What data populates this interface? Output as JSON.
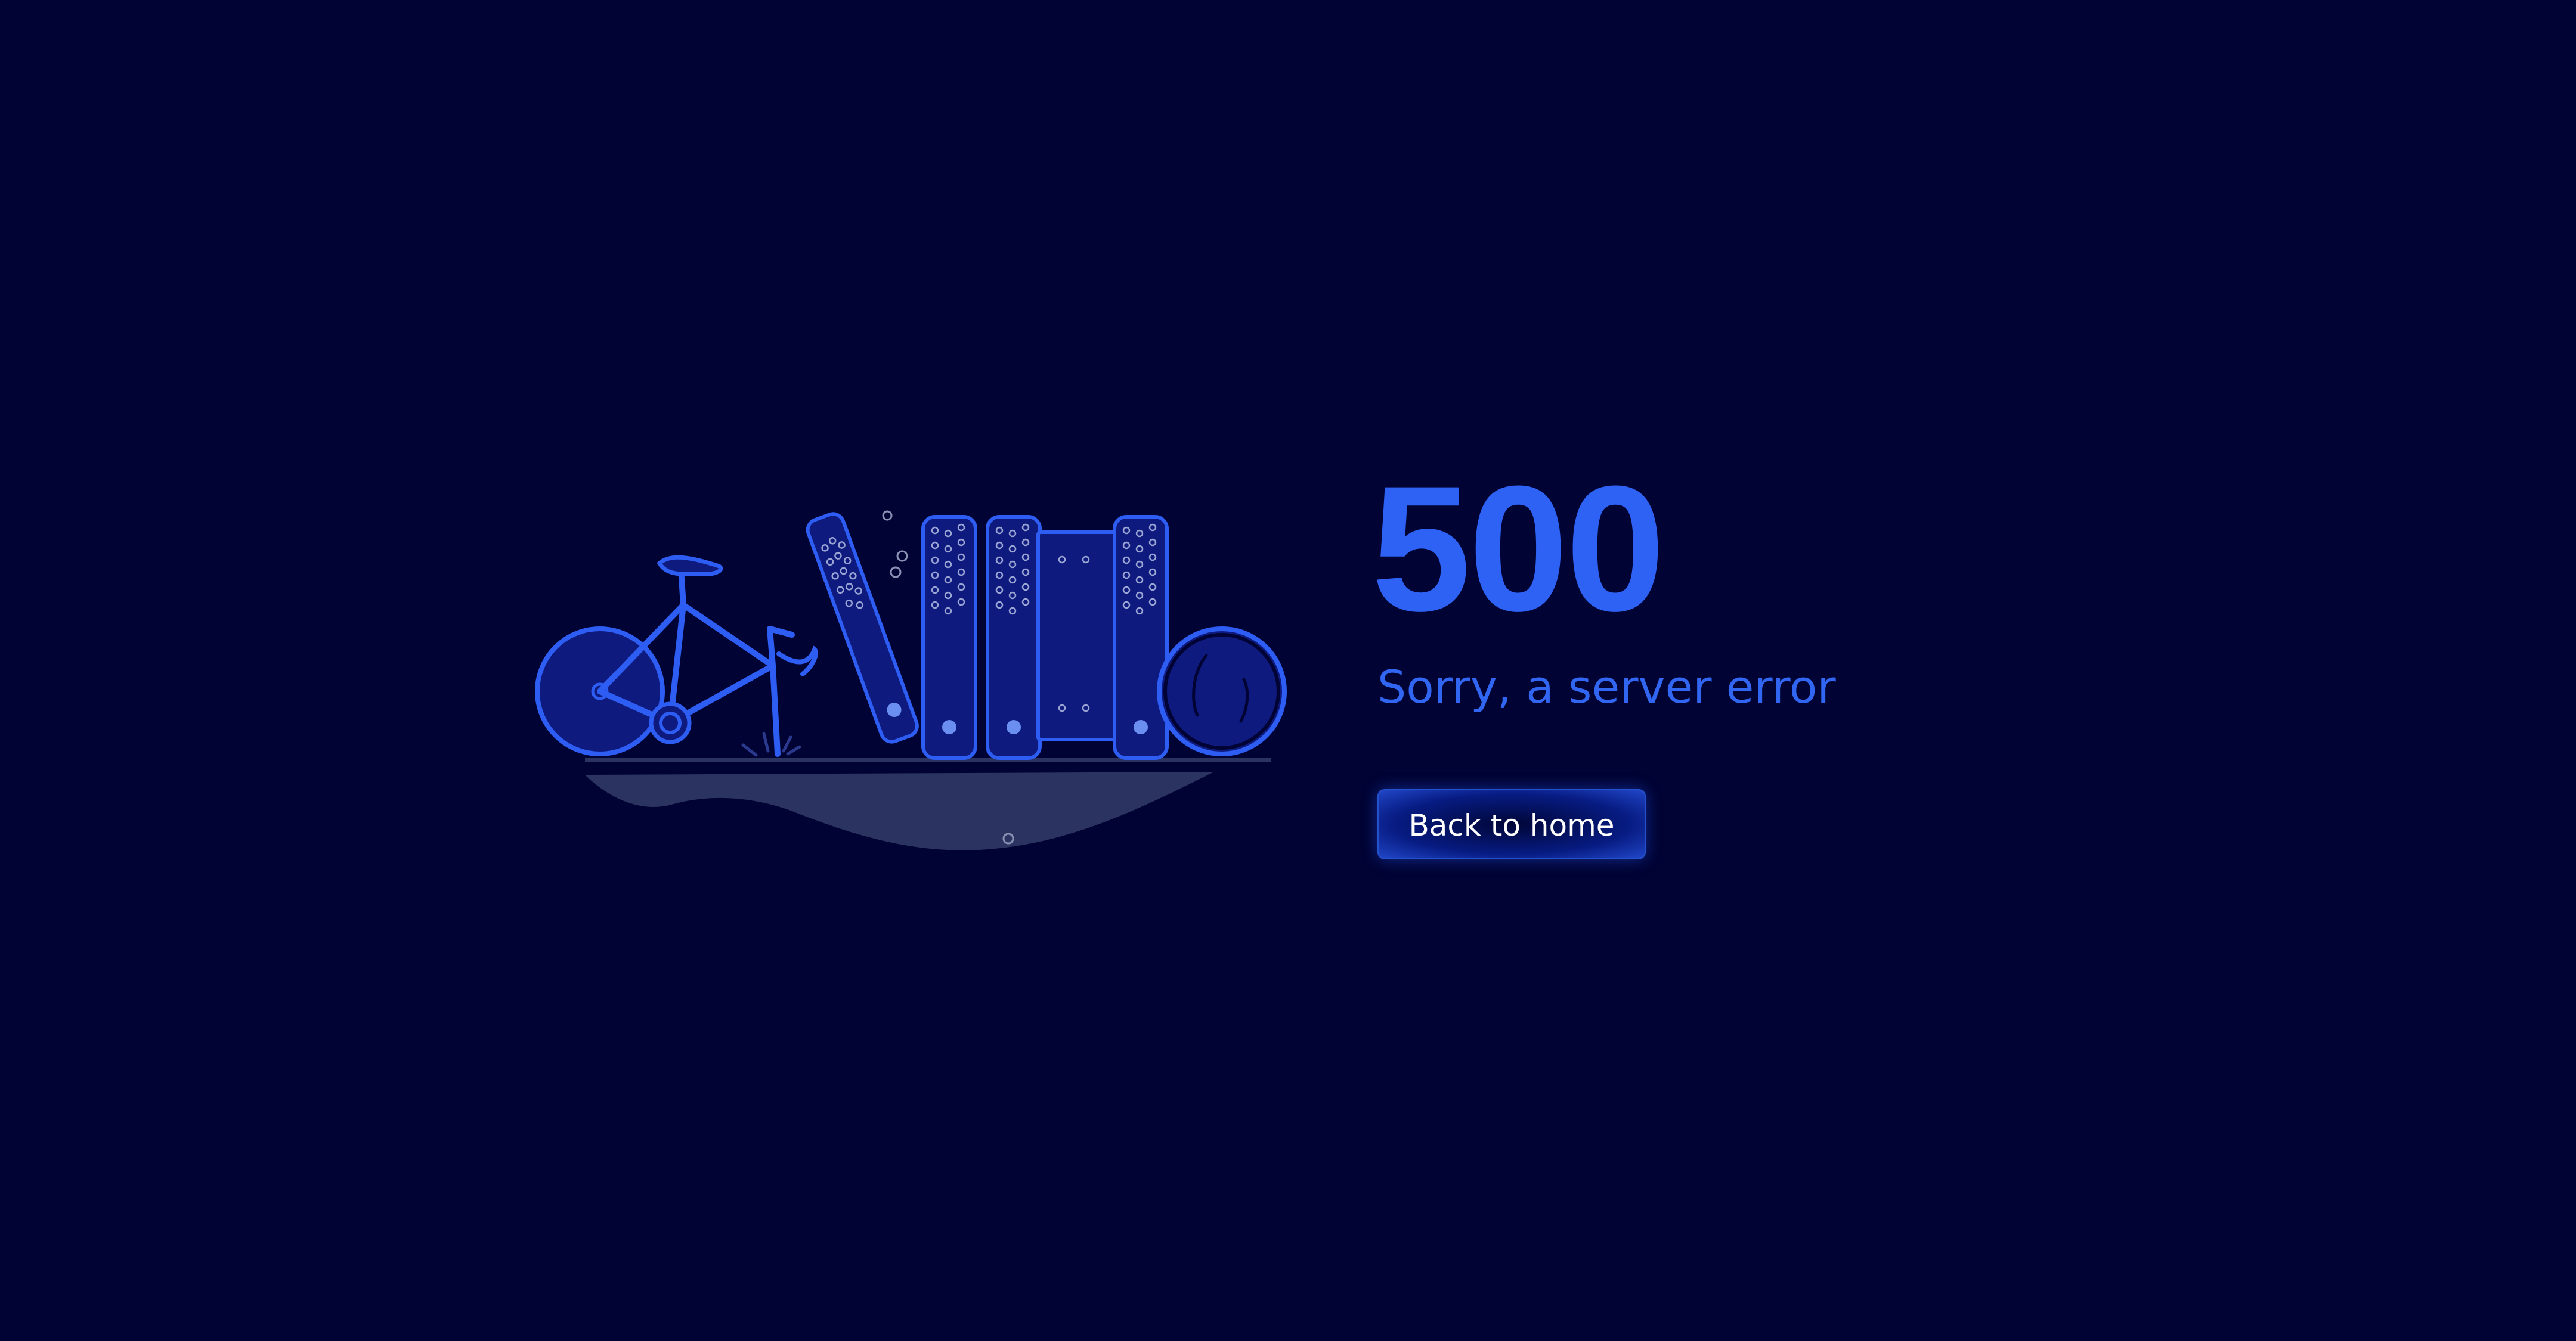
{
  "error": {
    "code": "500",
    "message": "Sorry, a server error"
  },
  "actions": {
    "back_home_label": "Back to home"
  },
  "colors": {
    "background": "#000333",
    "accent": "#2e62f5",
    "illustration_fill": "#0f1a7f",
    "illustration_stroke": "#2d5df2",
    "ground": "#2b3360"
  }
}
